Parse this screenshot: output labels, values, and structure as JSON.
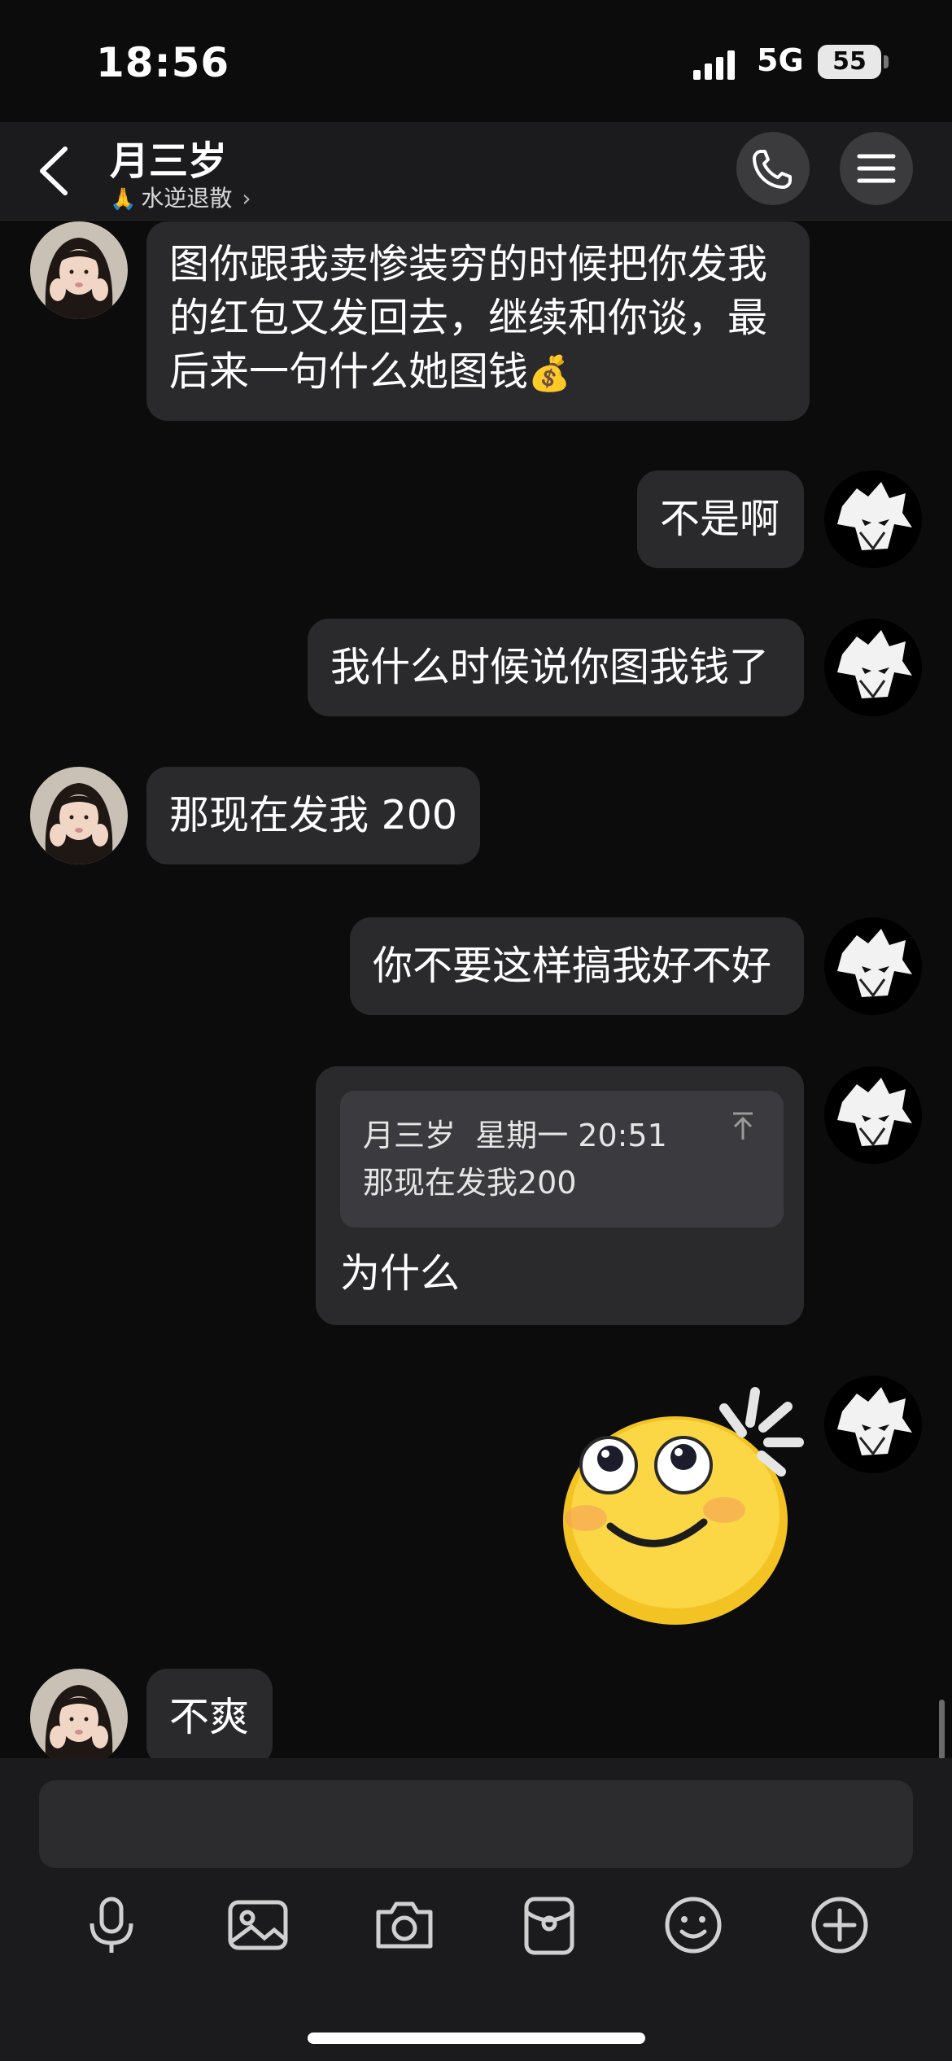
{
  "status_bar": {
    "time": "18:56",
    "network": "5G",
    "battery": "55"
  },
  "header": {
    "title": "月三岁",
    "subtitle_emoji": "🙏",
    "subtitle": "水逆退散",
    "subtitle_chevron": "›"
  },
  "messages": [
    {
      "side": "left",
      "lines": [
        "图你跟我卖惨装穷的时候把你发我",
        "的红包又发回去，继续和你谈，最",
        "后来一句什么她图钱"
      ],
      "trailing_emoji": "💰"
    },
    {
      "side": "right",
      "text": "不是啊"
    },
    {
      "side": "right",
      "text": "我什么时候说你图我钱了"
    },
    {
      "side": "left",
      "text": "那现在发我 200"
    },
    {
      "side": "right",
      "text": "你不要这样搞我好不好"
    },
    {
      "side": "right",
      "quote": {
        "sender": "月三岁",
        "time": "星期一 20:51",
        "text": "那现在发我200"
      },
      "text": "为什么"
    },
    {
      "side": "right",
      "sticker": "smiling-face-sticker"
    },
    {
      "side": "left",
      "text": "不爽"
    }
  ],
  "input": {
    "placeholder": ""
  },
  "toolbar_icons": [
    "microphone-icon",
    "image-icon",
    "camera-icon",
    "red-packet-icon",
    "emoji-icon",
    "plus-icon"
  ],
  "colors": {
    "background": "#0c0c0c",
    "bubble": "#2a2a2c",
    "header": "#1b1b1d"
  }
}
